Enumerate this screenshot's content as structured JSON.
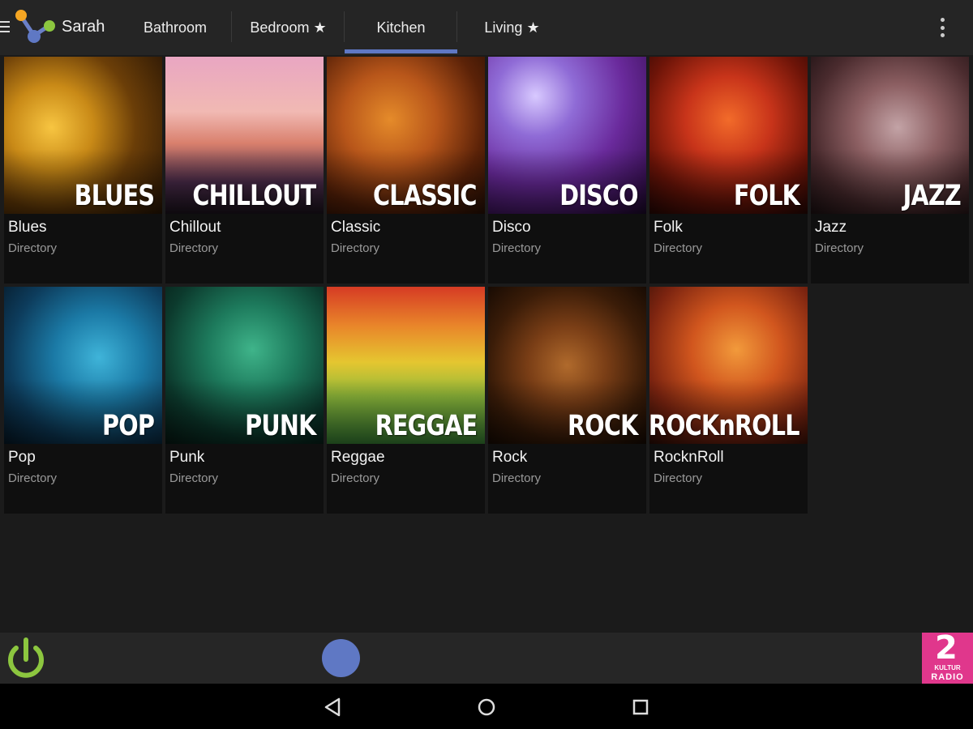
{
  "header": {
    "user_name": "Sarah",
    "tabs": [
      {
        "label": "Bathroom"
      },
      {
        "label": "Bedroom ★"
      },
      {
        "label": "Kitchen",
        "active": true
      },
      {
        "label": "Living ★"
      }
    ]
  },
  "library": {
    "items": [
      {
        "title": "Blues",
        "subtitle": "Directory",
        "art_label": "BLUES"
      },
      {
        "title": "Chillout",
        "subtitle": "Directory",
        "art_label": "CHILLOUT"
      },
      {
        "title": "Classic",
        "subtitle": "Directory",
        "art_label": "CLASSIC"
      },
      {
        "title": "Disco",
        "subtitle": "Directory",
        "art_label": "DISCO"
      },
      {
        "title": "Folk",
        "subtitle": "Directory",
        "art_label": "FOLK"
      },
      {
        "title": "Jazz",
        "subtitle": "Directory",
        "art_label": "JAZZ"
      },
      {
        "title": "Pop",
        "subtitle": "Directory",
        "art_label": "POP"
      },
      {
        "title": "Punk",
        "subtitle": "Directory",
        "art_label": "PUNK"
      },
      {
        "title": "Reggae",
        "subtitle": "Directory",
        "art_label": "REGGAE"
      },
      {
        "title": "Rock",
        "subtitle": "Directory",
        "art_label": "ROCK"
      },
      {
        "title": "RocknRoll",
        "subtitle": "Directory",
        "art_label": "ROCKnROLL"
      }
    ]
  },
  "player": {
    "station_number": "2",
    "station_tag": "KULTUR",
    "station_name": "RADIO"
  },
  "colors": {
    "accent": "#5f78c4",
    "power": "#8cc63f",
    "station": "#e0378c"
  },
  "icons": {
    "menu": "hamburger-icon",
    "logo": "app-logo",
    "overflow": "overflow-menu-icon",
    "power": "power-icon",
    "back": "back-icon",
    "home": "home-icon",
    "recents": "recents-icon"
  }
}
